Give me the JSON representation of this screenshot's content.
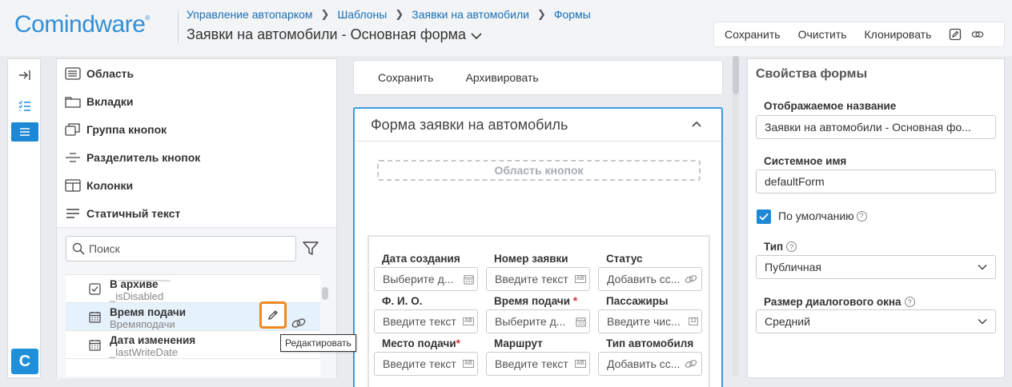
{
  "brand": {
    "logo": "Comindware",
    "logo_mark": "®"
  },
  "breadcrumb": [
    "Управление автопарком",
    "Шаблоны",
    "Заявки на автомобили",
    "Формы"
  ],
  "page_title": "Заявки на автомобили - Основная форма",
  "toolbar": {
    "save": "Сохранить",
    "clear": "Очистить",
    "clone": "Клонировать"
  },
  "rail": {
    "app_letter": "C"
  },
  "elements": {
    "items": [
      "Область",
      "Вкладки",
      "Группа кнопок",
      "Разделитель кнопок",
      "Колонки",
      "Статичный текст"
    ],
    "search_placeholder": "Поиск",
    "clipped_text": "_________",
    "attributes": [
      {
        "name": "В архиве",
        "system": "_isDisabled"
      },
      {
        "name": "Время подачи",
        "system": "Времяподачи"
      },
      {
        "name": "Дата изменения",
        "system": "_lastWriteDate"
      }
    ],
    "tooltip": "Редактировать"
  },
  "center": {
    "actions": [
      "Сохранить",
      "Архивировать"
    ],
    "form_title": "Форма заявки на автомобиль",
    "button_area": "Область кнопок",
    "fields": [
      {
        "label": "Дата создания",
        "required": false,
        "placeholder": "Выберите д...",
        "icon": "calendar-icon"
      },
      {
        "label": "Номер заявки",
        "required": false,
        "placeholder": "Введите текст",
        "icon": "text-ab-icon"
      },
      {
        "label": "Статус",
        "required": false,
        "placeholder": "Добавить сс...",
        "icon": "link-icon"
      },
      {
        "label": "Ф. И. О.",
        "required": false,
        "placeholder": "Введите текст",
        "icon": "text-ab-icon"
      },
      {
        "label": "Время подачи",
        "required": true,
        "placeholder": "Выберите д...",
        "icon": "calendar-icon"
      },
      {
        "label": "Пассажиры",
        "required": false,
        "placeholder": "Введите чис...",
        "icon": "number-icon"
      },
      {
        "label": "Место подачи",
        "required": true,
        "placeholder": "Введите текст",
        "icon": "text-ab-icon"
      },
      {
        "label": "Маршрут",
        "required": false,
        "placeholder": "Введите текст",
        "icon": "text-ab-icon"
      },
      {
        "label": "Тип автомобиля",
        "required": false,
        "placeholder": "Добавить сс...",
        "icon": "link-icon"
      }
    ],
    "required_mark": "*",
    "ab_glyph": "AB",
    "num_glyph": "12"
  },
  "props": {
    "title": "Свойства формы",
    "display_name_label": "Отображаемое название",
    "display_name_value": "Заявки на автомобили - Основная фо...",
    "system_name_label": "Системное имя",
    "system_name_value": "defaultForm",
    "default_label": "По умолчанию",
    "default_checked": true,
    "type_label": "Тип",
    "type_value": "Публичная",
    "dialog_size_label": "Размер диалогового окна",
    "dialog_size_value": "Средний",
    "help_glyph": "?"
  },
  "colors": {
    "accent": "#1e88d6",
    "link": "#1a6fb5",
    "highlight": "#f08a24",
    "required": "#d9303a"
  }
}
